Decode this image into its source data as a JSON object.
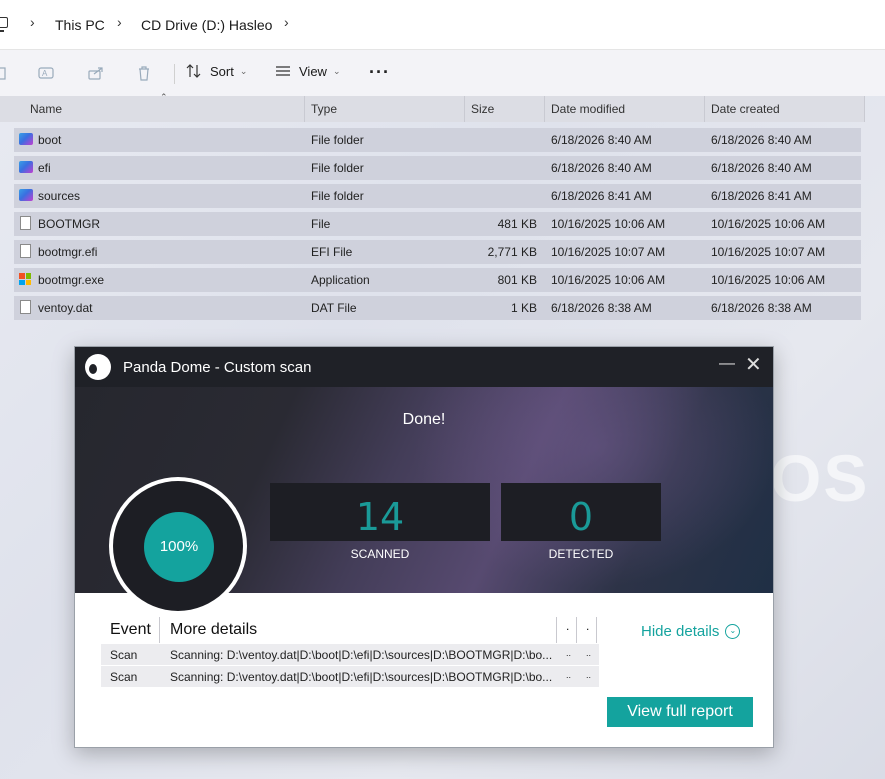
{
  "explorer": {
    "breadcrumb": [
      "This PC",
      "CD Drive (D:) Hasleo"
    ],
    "toolbar": {
      "sort_label": "Sort",
      "view_label": "View",
      "more_label": "···"
    },
    "columns": [
      "Name",
      "Type",
      "Size",
      "Date modified",
      "Date created"
    ],
    "files": [
      {
        "icon": "folder-icon",
        "name": "boot",
        "type": "File folder",
        "size": "",
        "modified": "6/18/2026 8:40 AM",
        "created": "6/18/2026 8:40 AM"
      },
      {
        "icon": "folder-icon",
        "name": "efi",
        "type": "File folder",
        "size": "",
        "modified": "6/18/2026 8:40 AM",
        "created": "6/18/2026 8:40 AM"
      },
      {
        "icon": "folder-icon",
        "name": "sources",
        "type": "File folder",
        "size": "",
        "modified": "6/18/2026 8:41 AM",
        "created": "6/18/2026 8:41 AM"
      },
      {
        "icon": "file-icon",
        "name": "BOOTMGR",
        "type": "File",
        "size": "481 KB",
        "modified": "10/16/2025 10:06 AM",
        "created": "10/16/2025 10:06 AM"
      },
      {
        "icon": "file-icon",
        "name": "bootmgr.efi",
        "type": "EFI File",
        "size": "2,771 KB",
        "modified": "10/16/2025 10:07 AM",
        "created": "10/16/2025 10:07 AM"
      },
      {
        "icon": "exe-icon",
        "name": "bootmgr.exe",
        "type": "Application",
        "size": "801 KB",
        "modified": "10/16/2025 10:06 AM",
        "created": "10/16/2025 10:06 AM"
      },
      {
        "icon": "file-icon",
        "name": "ventoy.dat",
        "type": "DAT File",
        "size": "1 KB",
        "modified": "6/18/2026 8:38 AM",
        "created": "6/18/2026 8:38 AM"
      }
    ],
    "watermark": "OS"
  },
  "panda": {
    "title": "Panda Dome - Custom scan",
    "status": "Done!",
    "progress_label": "100%",
    "progress": 100,
    "scanned_count": "14",
    "scanned_label": "SCANNED",
    "detected_count": "0",
    "detected_label": "DETECTED",
    "table": {
      "headers": [
        "Event",
        "More details",
        ".",
        "."
      ],
      "rows": [
        {
          "event": "Scan",
          "details": "Scanning: D:\\ventoy.dat|D:\\boot|D:\\efi|D:\\sources|D:\\BOOTMGR|D:\\bo...",
          "c3": "..",
          "c4": ".."
        },
        {
          "event": "Scan",
          "details": "Scanning: D:\\ventoy.dat|D:\\boot|D:\\efi|D:\\sources|D:\\BOOTMGR|D:\\bo...",
          "c3": "..",
          "c4": ".."
        }
      ]
    },
    "hide_details_label": "Hide details",
    "report_button_label": "View full report",
    "accent": "#14a39e"
  }
}
